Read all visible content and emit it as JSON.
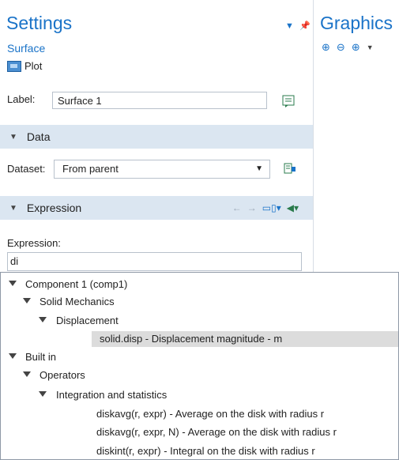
{
  "settings": {
    "title": "Settings",
    "subtitle": "Surface",
    "plot_label": "Plot",
    "label_caption": "Label:",
    "label_value": "Surface 1"
  },
  "graphics": {
    "title": "Graphics"
  },
  "sections": {
    "data": "Data",
    "expression": "Expression"
  },
  "dataset": {
    "caption": "Dataset:",
    "value": "From parent"
  },
  "expression": {
    "caption": "Expression:",
    "value": "di"
  },
  "tree": [
    {
      "label": "Component 1 (comp1)"
    },
    {
      "label": "Solid Mechanics"
    },
    {
      "label": "Displacement"
    },
    {
      "label": "solid.disp - Displacement magnitude - m"
    },
    {
      "label": "Built in"
    },
    {
      "label": "Operators"
    },
    {
      "label": "Integration and statistics"
    },
    {
      "label": "diskavg(r, expr) - Average on the disk with radius r"
    },
    {
      "label": "diskavg(r, expr, N) - Average on the disk with radius r"
    },
    {
      "label": "diskint(r, expr) - Integral on the disk with radius r"
    }
  ],
  "icons": {
    "pin": "pin-icon",
    "plot": "plot-icon",
    "zoom_in": "zoom-in-icon",
    "zoom_out": "zoom-out-icon",
    "zoom_box": "zoom-box-icon",
    "dropdown": "chevron-down-icon"
  },
  "colors": {
    "accent": "#1a73c8",
    "section_bg": "#dbe6f1",
    "selection_bg": "#dcdcdc"
  }
}
